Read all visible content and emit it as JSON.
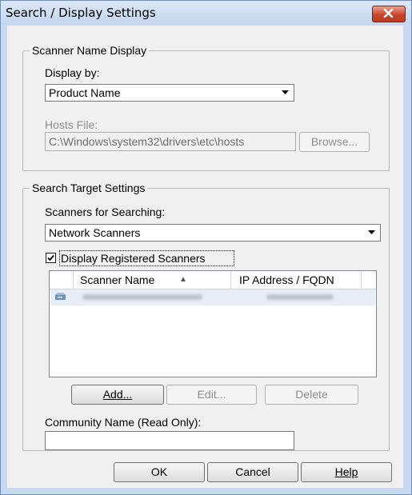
{
  "window": {
    "title": "Search / Display Settings",
    "close_icon": "close-icon"
  },
  "name_display": {
    "legend": "Scanner Name Display",
    "display_by_label": "Display by:",
    "display_by_value": "Product Name",
    "hosts_file_label": "Hosts File:",
    "hosts_file_value": "C:\\Windows\\system32\\drivers\\etc\\hosts",
    "browse_label": "Browse..."
  },
  "search_target": {
    "legend": "Search Target Settings",
    "scanners_label": "Scanners for Searching:",
    "scanners_value": "Network Scanners",
    "display_registered_label": "Display Registered Scanners",
    "display_registered_checked": true,
    "table": {
      "columns": [
        "Scanner Name",
        "IP Address / FQDN"
      ],
      "sort_indicator": "▲",
      "rows": [
        {
          "icon": "scanner-icon",
          "redacted": true
        }
      ]
    },
    "add_label": "Add...",
    "edit_label": "Edit...",
    "delete_label": "Delete",
    "community_label": "Community Name (Read Only):",
    "community_value": ""
  },
  "footer": {
    "ok_label": "OK",
    "cancel_label": "Cancel",
    "help_label": "Help"
  }
}
